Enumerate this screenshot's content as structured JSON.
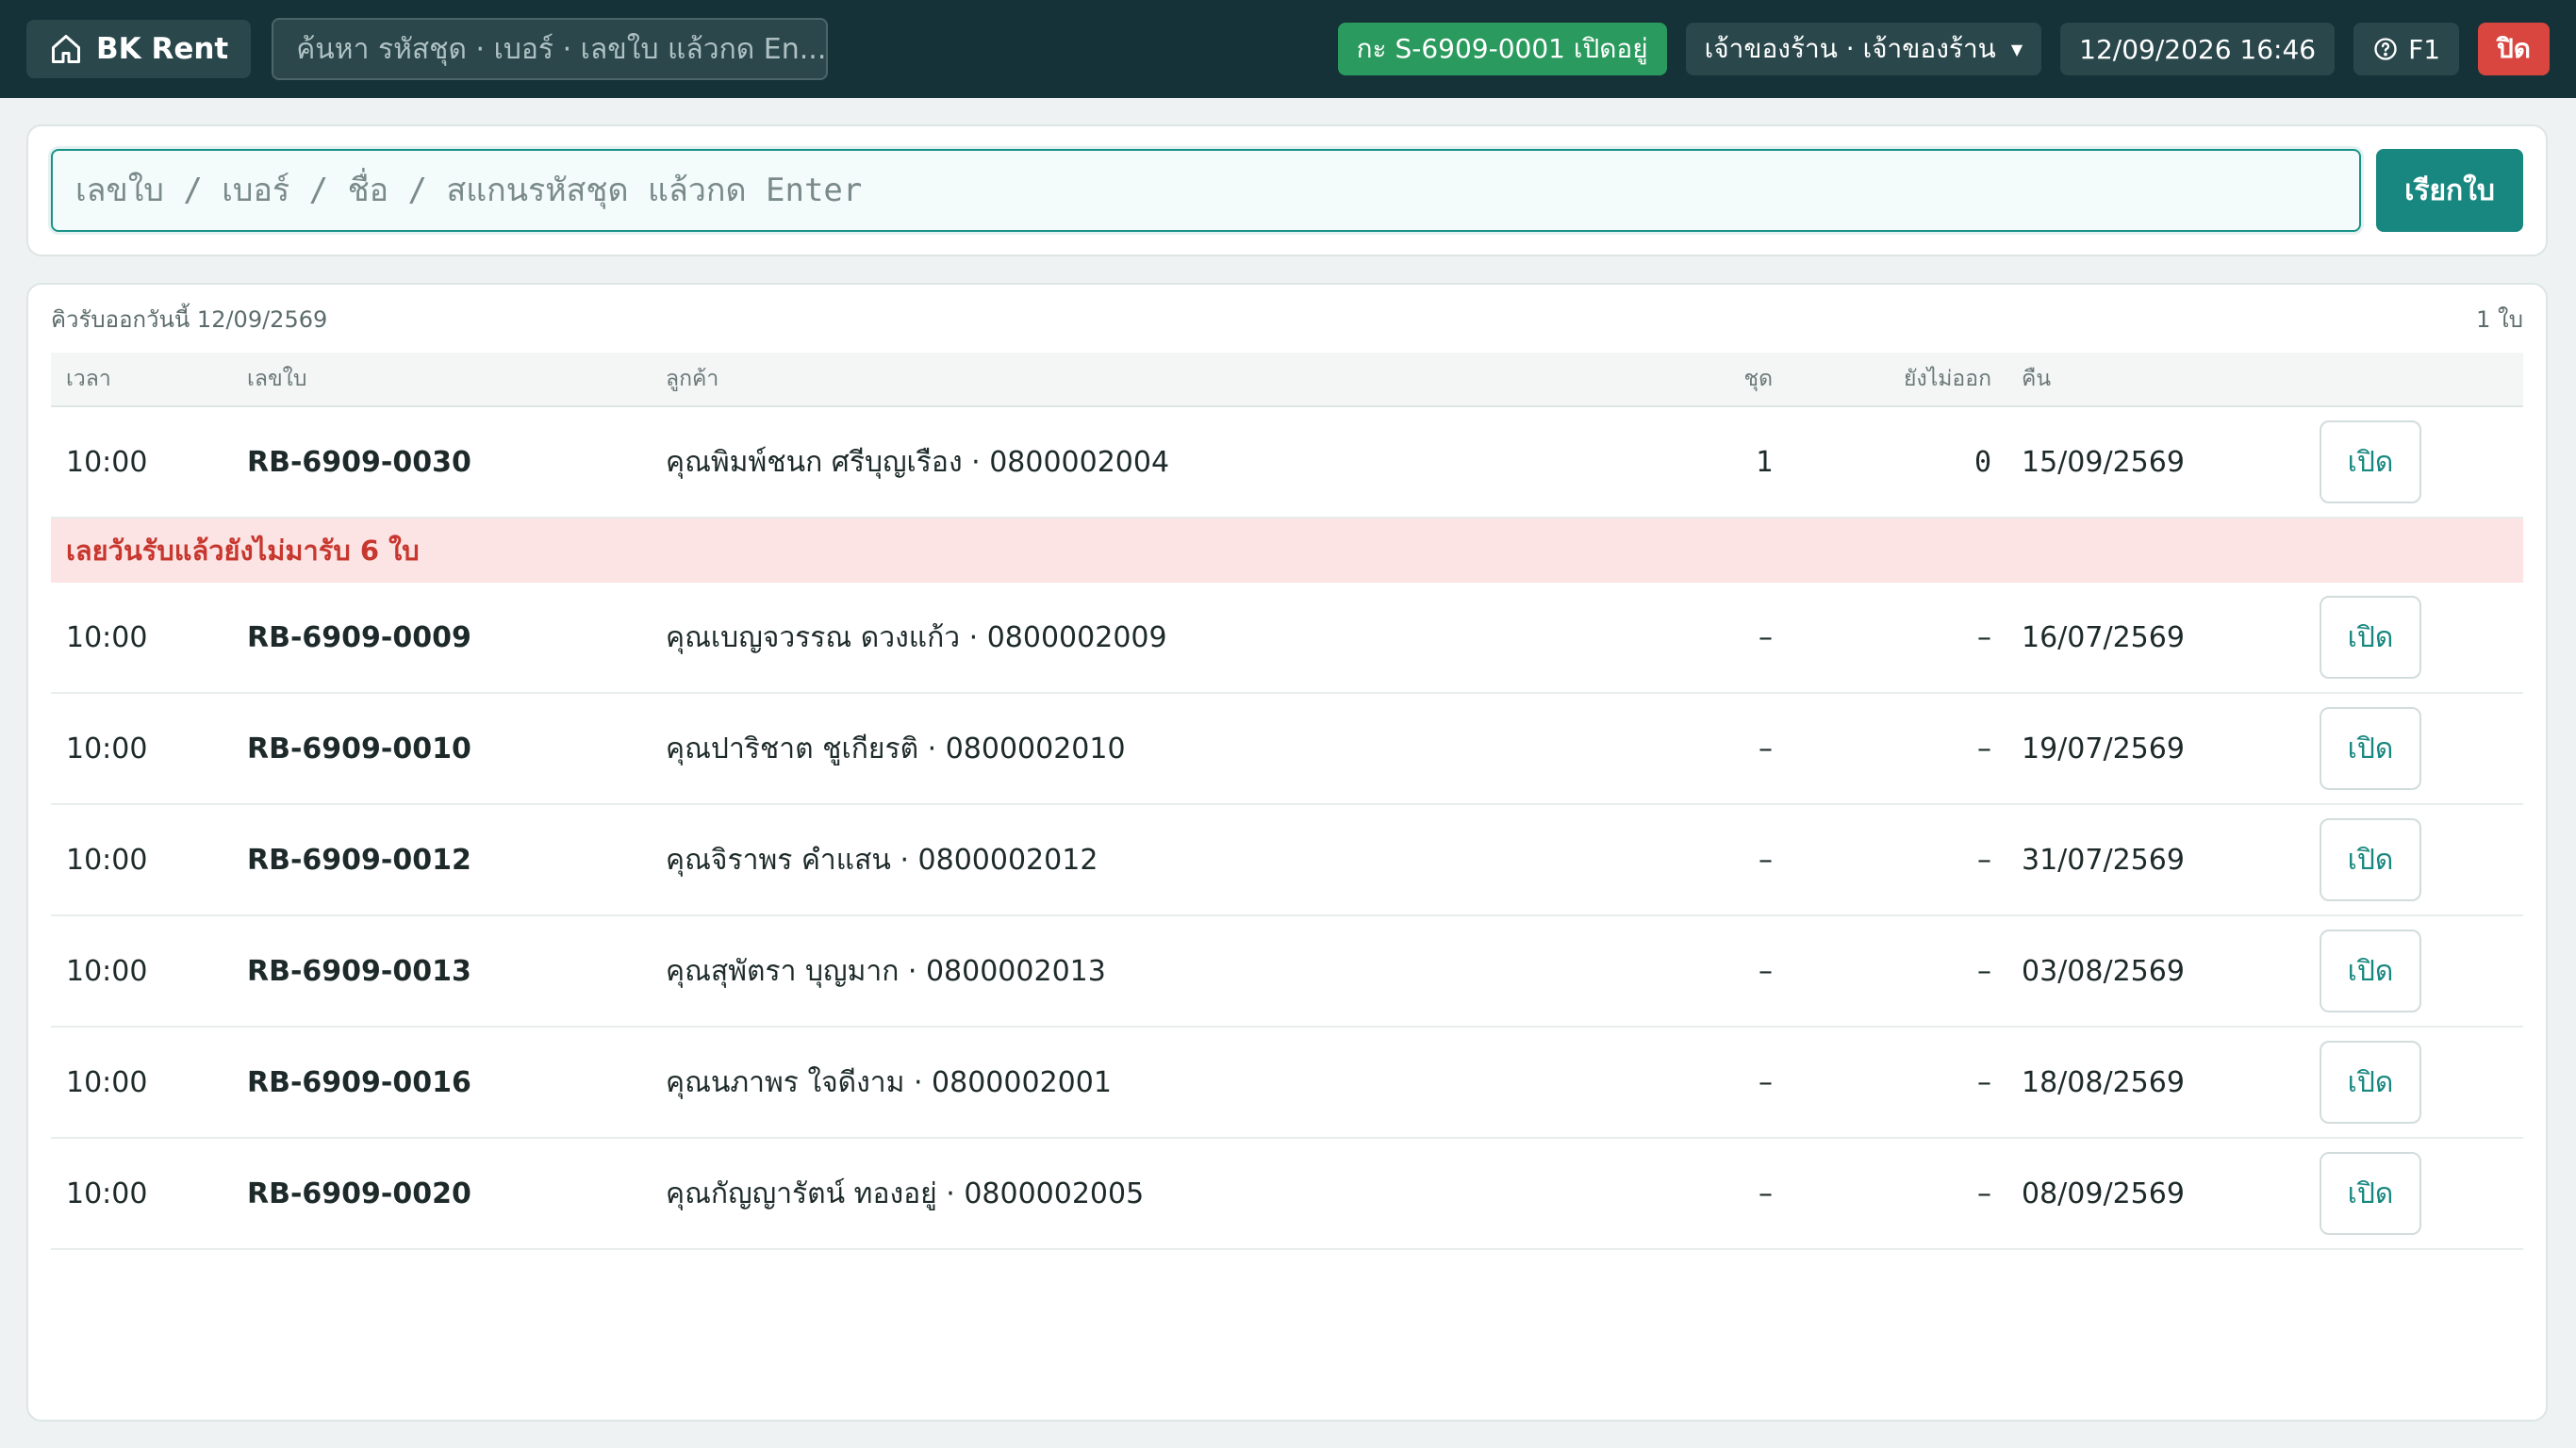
{
  "topbar": {
    "brand": "BK Rent",
    "search_placeholder": "ค้นหา รหัสชุด · เบอร์ · เลขใบ แล้วกด En...",
    "session": "กะ S-6909-0001 เปิดอยู่",
    "user": "เจ้าของร้าน · เจ้าของร้าน",
    "datetime": "12/09/2026 16:46",
    "help": "F1",
    "close": "ปิด"
  },
  "scan": {
    "placeholder": "เลขใบ / เบอร์ / ชื่อ / สแกนรหัสชุด แล้วกด Enter",
    "button": "เรียกใบ"
  },
  "list": {
    "title": "คิวรับออกวันนี้ 12/09/2569",
    "count": "1 ใบ",
    "columns": {
      "time": "เวลา",
      "no": "เลขใบ",
      "customer": "ลูกค้า",
      "sets": "ชุด",
      "not_out": "ยังไม่ออก",
      "return": "คืน"
    },
    "today": [
      {
        "time": "10:00",
        "no": "RB-6909-0030",
        "customer": "คุณพิมพ์ชนก ศรีบุญเรือง · 0800002004",
        "sets": "1",
        "not_out": "0",
        "return": "15/09/2569",
        "action": "เปิด"
      }
    ],
    "overdue_label": "เลยวันรับแล้วยังไม่มารับ 6 ใบ",
    "overdue": [
      {
        "time": "10:00",
        "no": "RB-6909-0009",
        "customer": "คุณเบญจวรรณ ดวงแก้ว · 0800002009",
        "sets": "–",
        "not_out": "–",
        "return": "16/07/2569",
        "action": "เปิด"
      },
      {
        "time": "10:00",
        "no": "RB-6909-0010",
        "customer": "คุณปาริชาต ชูเกียรติ · 0800002010",
        "sets": "–",
        "not_out": "–",
        "return": "19/07/2569",
        "action": "เปิด"
      },
      {
        "time": "10:00",
        "no": "RB-6909-0012",
        "customer": "คุณจิราพร คำแสน · 0800002012",
        "sets": "–",
        "not_out": "–",
        "return": "31/07/2569",
        "action": "เปิด"
      },
      {
        "time": "10:00",
        "no": "RB-6909-0013",
        "customer": "คุณสุพัตรา บุญมาก · 0800002013",
        "sets": "–",
        "not_out": "–",
        "return": "03/08/2569",
        "action": "เปิด"
      },
      {
        "time": "10:00",
        "no": "RB-6909-0016",
        "customer": "คุณนภาพร ใจดีงาม · 0800002001",
        "sets": "–",
        "not_out": "–",
        "return": "18/08/2569",
        "action": "เปิด"
      },
      {
        "time": "10:00",
        "no": "RB-6909-0020",
        "customer": "คุณกัญญารัตน์ ทองอยู่ · 0800002005",
        "sets": "–",
        "not_out": "–",
        "return": "08/09/2569",
        "action": "เปิด"
      }
    ]
  },
  "icons": {
    "brand": "home-icon",
    "help": "help-circle-icon",
    "user_menu": "chevron-down-icon"
  },
  "colors": {
    "topbar": "#143237",
    "accent": "#17877f",
    "session": "#2b9a5e",
    "danger": "#d9453f",
    "overdue_bg": "#fbe4e3"
  }
}
